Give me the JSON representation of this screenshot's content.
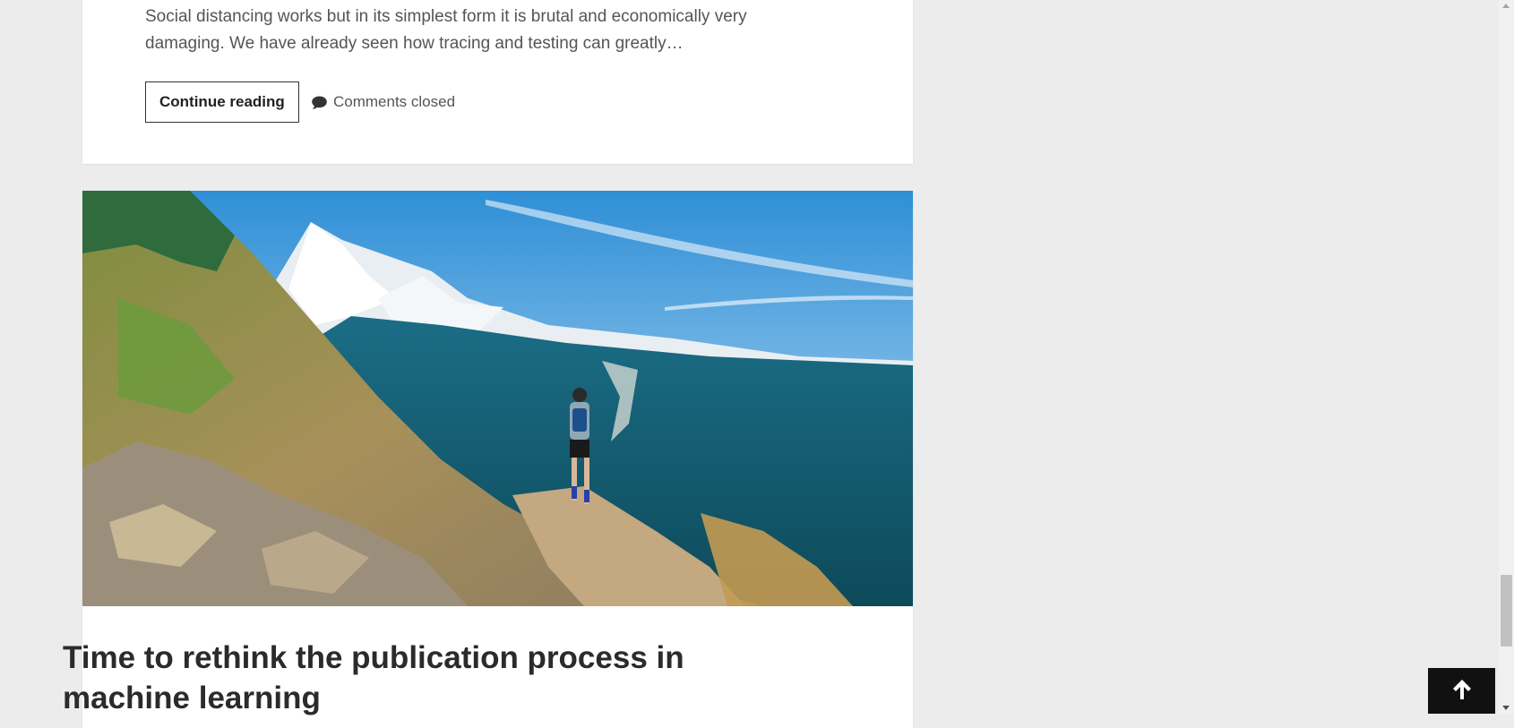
{
  "previous_post": {
    "excerpt": "Social distancing works but in its simplest form it is brutal and economically very damaging. We have already seen how tracing and testing can greatly…",
    "continue_label": "Continue reading",
    "comments_label": "Comments closed",
    "comment_icon": "comment-bubble-icon"
  },
  "next_post": {
    "image_alt": "Trail runner on a mountain path above a forested valley with a snow-capped peak",
    "title": "Time to rethink the publication process in machine learning"
  },
  "back_to_top": {
    "icon": "arrow-up-icon",
    "color": "#111111"
  }
}
